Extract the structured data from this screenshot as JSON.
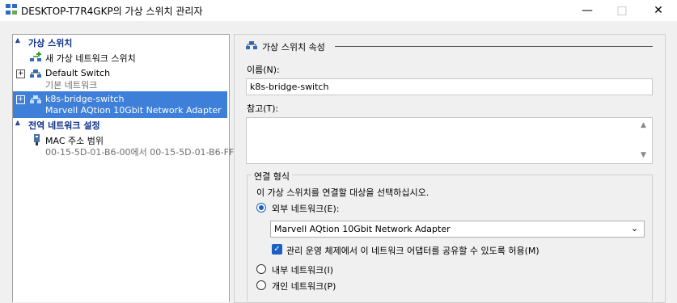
{
  "window": {
    "title": "DESKTOP-T7R4GKP의 가상 스위치 관리자",
    "minimize": "—",
    "maximize": "□",
    "close": "✕"
  },
  "left": {
    "section1": "가상 스위치",
    "new_switch": "새 가상 네트워크 스위치",
    "default_switch": {
      "name": "Default Switch",
      "sub": "기본 네트워크"
    },
    "k8s_switch": {
      "name": "k8s-bridge-switch",
      "sub": "Marvell AQtion 10Gbit Network Adapter"
    },
    "section2": "전역 네트워크 설정",
    "mac": {
      "name": "MAC 주소 범위",
      "sub": "00-15-5D-01-B6-00에서 00-15-5D-01-B6-FF"
    }
  },
  "right": {
    "props_title": "가상 스위치 속성",
    "name_label": "이름(N):",
    "name_value": "k8s-bridge-switch",
    "notes_label": "참고(T):",
    "notes_value": "",
    "conn_group": "연결 형식",
    "conn_desc": "이 가상 스위치를 연결할 대상을 선택하십시오.",
    "external": "외부 네트워크(E):",
    "adapter": "Marvell AQtion 10Gbit Network Adapter",
    "share_mgmt": "관리 운영 체제에서 이 네트워크 어댑터를 공유할 수 있도록 허용(M)",
    "internal": "내부 네트워크(I)",
    "private": "개인 네트워크(P)"
  }
}
